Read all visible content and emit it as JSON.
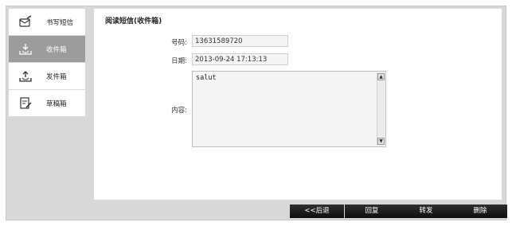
{
  "sidebar": {
    "items": [
      {
        "label": "书写短信",
        "icon": "compose-icon"
      },
      {
        "label": "收件箱",
        "icon": "inbox-icon"
      },
      {
        "label": "发件箱",
        "icon": "outbox-icon"
      },
      {
        "label": "草稿箱",
        "icon": "drafts-icon"
      }
    ],
    "active_index": 1
  },
  "panel": {
    "title": "阅读短信(收件箱)",
    "number_label": "号码:",
    "number_value": "13631589720",
    "date_label": "日期:",
    "date_value": "2013-09-24 17:13:13",
    "content_label": "内容:",
    "content_value": "salut"
  },
  "buttons": {
    "back": "<<后退",
    "reply": "回复",
    "forward": "转发",
    "delete": "删除"
  },
  "colors": {
    "active_item": "#9c9c9c",
    "button_bg": "#111111",
    "frame_bg": "#d8d8d8"
  }
}
